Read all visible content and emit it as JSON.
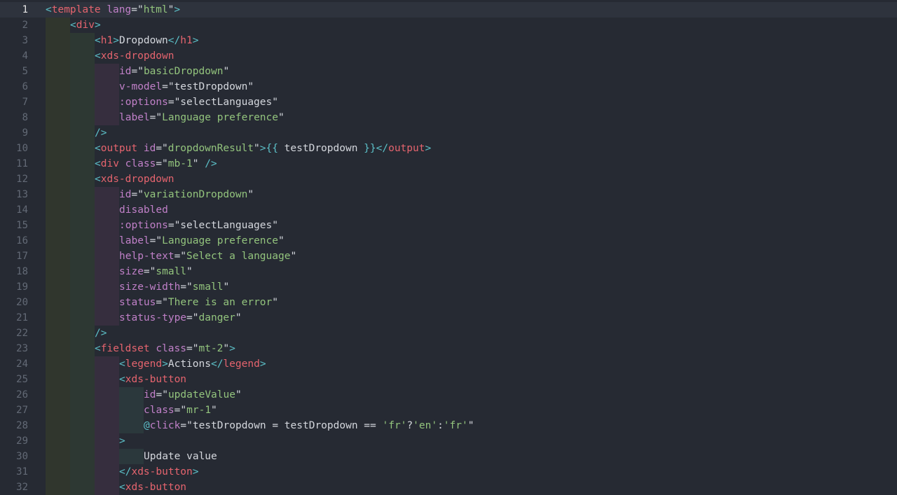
{
  "editor": {
    "active_line": 1,
    "colors": {
      "tag": "#e5646e",
      "punct": "#5cc0c8",
      "attr": "#c080c8",
      "string": "#93c47d",
      "text": "#d4d7dd",
      "background": "#262a33"
    },
    "lines": [
      {
        "n": "1",
        "d": 0,
        "tokens": [
          [
            "p",
            "<"
          ],
          [
            "t",
            "template"
          ],
          [
            "x",
            " "
          ],
          [
            "a",
            "lang"
          ],
          [
            "x",
            "=\""
          ],
          [
            "s",
            "html"
          ],
          [
            "x",
            "\""
          ],
          [
            "p",
            ">"
          ]
        ]
      },
      {
        "n": "2",
        "d": 1,
        "tokens": [
          [
            "p",
            "<"
          ],
          [
            "t",
            "div"
          ],
          [
            "p",
            ">"
          ]
        ]
      },
      {
        "n": "3",
        "d": 2,
        "tokens": [
          [
            "p",
            "<"
          ],
          [
            "t",
            "h1"
          ],
          [
            "p",
            ">"
          ],
          [
            "x",
            "Dropdown"
          ],
          [
            "p",
            "</"
          ],
          [
            "t",
            "h1"
          ],
          [
            "p",
            ">"
          ]
        ]
      },
      {
        "n": "4",
        "d": 2,
        "tokens": [
          [
            "p",
            "<"
          ],
          [
            "t",
            "xds-dropdown"
          ]
        ]
      },
      {
        "n": "5",
        "d": 3,
        "tokens": [
          [
            "a",
            "id"
          ],
          [
            "x",
            "=\""
          ],
          [
            "s",
            "basicDropdown"
          ],
          [
            "x",
            "\""
          ]
        ]
      },
      {
        "n": "6",
        "d": 3,
        "tokens": [
          [
            "a",
            "v-model"
          ],
          [
            "x",
            "=\"testDropdown\""
          ]
        ]
      },
      {
        "n": "7",
        "d": 3,
        "tokens": [
          [
            "a",
            ":options"
          ],
          [
            "x",
            "=\"selectLanguages\""
          ]
        ]
      },
      {
        "n": "8",
        "d": 3,
        "tokens": [
          [
            "a",
            "label"
          ],
          [
            "x",
            "=\""
          ],
          [
            "s",
            "Language preference"
          ],
          [
            "x",
            "\""
          ]
        ]
      },
      {
        "n": "9",
        "d": 2,
        "tokens": [
          [
            "p",
            "/>"
          ]
        ]
      },
      {
        "n": "10",
        "d": 2,
        "tokens": [
          [
            "p",
            "<"
          ],
          [
            "t",
            "output"
          ],
          [
            "x",
            " "
          ],
          [
            "a",
            "id"
          ],
          [
            "x",
            "=\""
          ],
          [
            "s",
            "dropdownResult"
          ],
          [
            "x",
            "\""
          ],
          [
            "p",
            ">{{"
          ],
          [
            "x",
            " testDropdown "
          ],
          [
            "p",
            "}}</"
          ],
          [
            "t",
            "output"
          ],
          [
            "p",
            ">"
          ]
        ]
      },
      {
        "n": "11",
        "d": 2,
        "tokens": [
          [
            "p",
            "<"
          ],
          [
            "t",
            "div"
          ],
          [
            "x",
            " "
          ],
          [
            "a",
            "class"
          ],
          [
            "x",
            "=\""
          ],
          [
            "s",
            "mb-1"
          ],
          [
            "x",
            "\" "
          ],
          [
            "p",
            "/>"
          ]
        ]
      },
      {
        "n": "12",
        "d": 2,
        "tokens": [
          [
            "p",
            "<"
          ],
          [
            "t",
            "xds-dropdown"
          ]
        ]
      },
      {
        "n": "13",
        "d": 3,
        "tokens": [
          [
            "a",
            "id"
          ],
          [
            "x",
            "=\""
          ],
          [
            "s",
            "variationDropdown"
          ],
          [
            "x",
            "\""
          ]
        ]
      },
      {
        "n": "14",
        "d": 3,
        "tokens": [
          [
            "a",
            "disabled"
          ]
        ]
      },
      {
        "n": "15",
        "d": 3,
        "tokens": [
          [
            "a",
            ":options"
          ],
          [
            "x",
            "=\"selectLanguages\""
          ]
        ]
      },
      {
        "n": "16",
        "d": 3,
        "tokens": [
          [
            "a",
            "label"
          ],
          [
            "x",
            "=\""
          ],
          [
            "s",
            "Language preference"
          ],
          [
            "x",
            "\""
          ]
        ]
      },
      {
        "n": "17",
        "d": 3,
        "tokens": [
          [
            "a",
            "help-text"
          ],
          [
            "x",
            "=\""
          ],
          [
            "s",
            "Select a language"
          ],
          [
            "x",
            "\""
          ]
        ]
      },
      {
        "n": "18",
        "d": 3,
        "tokens": [
          [
            "a",
            "size"
          ],
          [
            "x",
            "=\""
          ],
          [
            "s",
            "small"
          ],
          [
            "x",
            "\""
          ]
        ]
      },
      {
        "n": "19",
        "d": 3,
        "tokens": [
          [
            "a",
            "size-width"
          ],
          [
            "x",
            "=\""
          ],
          [
            "s",
            "small"
          ],
          [
            "x",
            "\""
          ]
        ]
      },
      {
        "n": "20",
        "d": 3,
        "tokens": [
          [
            "a",
            "status"
          ],
          [
            "x",
            "=\""
          ],
          [
            "s",
            "There is an error"
          ],
          [
            "x",
            "\""
          ]
        ]
      },
      {
        "n": "21",
        "d": 3,
        "tokens": [
          [
            "a",
            "status-type"
          ],
          [
            "x",
            "=\""
          ],
          [
            "s",
            "danger"
          ],
          [
            "x",
            "\""
          ]
        ]
      },
      {
        "n": "22",
        "d": 2,
        "tokens": [
          [
            "p",
            "/>"
          ]
        ]
      },
      {
        "n": "23",
        "d": 2,
        "tokens": [
          [
            "p",
            "<"
          ],
          [
            "t",
            "fieldset"
          ],
          [
            "x",
            " "
          ],
          [
            "a",
            "class"
          ],
          [
            "x",
            "=\""
          ],
          [
            "s",
            "mt-2"
          ],
          [
            "x",
            "\""
          ],
          [
            "p",
            ">"
          ]
        ]
      },
      {
        "n": "24",
        "d": 3,
        "tokens": [
          [
            "p",
            "<"
          ],
          [
            "t",
            "legend"
          ],
          [
            "p",
            ">"
          ],
          [
            "x",
            "Actions"
          ],
          [
            "p",
            "</"
          ],
          [
            "t",
            "legend"
          ],
          [
            "p",
            ">"
          ]
        ]
      },
      {
        "n": "25",
        "d": 3,
        "tokens": [
          [
            "p",
            "<"
          ],
          [
            "t",
            "xds-button"
          ]
        ]
      },
      {
        "n": "26",
        "d": 4,
        "tokens": [
          [
            "a",
            "id"
          ],
          [
            "x",
            "=\""
          ],
          [
            "s",
            "updateValue"
          ],
          [
            "x",
            "\""
          ]
        ]
      },
      {
        "n": "27",
        "d": 4,
        "tokens": [
          [
            "a",
            "class"
          ],
          [
            "x",
            "=\""
          ],
          [
            "s",
            "mr-1"
          ],
          [
            "x",
            "\""
          ]
        ]
      },
      {
        "n": "28",
        "d": 4,
        "tokens": [
          [
            "p",
            "@"
          ],
          [
            "a",
            "click"
          ],
          [
            "x",
            "=\"testDropdown = testDropdown == "
          ],
          [
            "s",
            "'fr'"
          ],
          [
            "x",
            "?"
          ],
          [
            "s",
            "'en'"
          ],
          [
            "x",
            ":"
          ],
          [
            "s",
            "'fr'"
          ],
          [
            "x",
            "\""
          ]
        ]
      },
      {
        "n": "29",
        "d": 3,
        "tokens": [
          [
            "p",
            ">"
          ]
        ]
      },
      {
        "n": "30",
        "d": 4,
        "tokens": [
          [
            "x",
            "Update value"
          ]
        ]
      },
      {
        "n": "31",
        "d": 3,
        "tokens": [
          [
            "p",
            "</"
          ],
          [
            "t",
            "xds-button"
          ],
          [
            "p",
            ">"
          ]
        ]
      },
      {
        "n": "32",
        "d": 3,
        "tokens": [
          [
            "p",
            "<"
          ],
          [
            "t",
            "xds-button"
          ]
        ]
      }
    ]
  }
}
